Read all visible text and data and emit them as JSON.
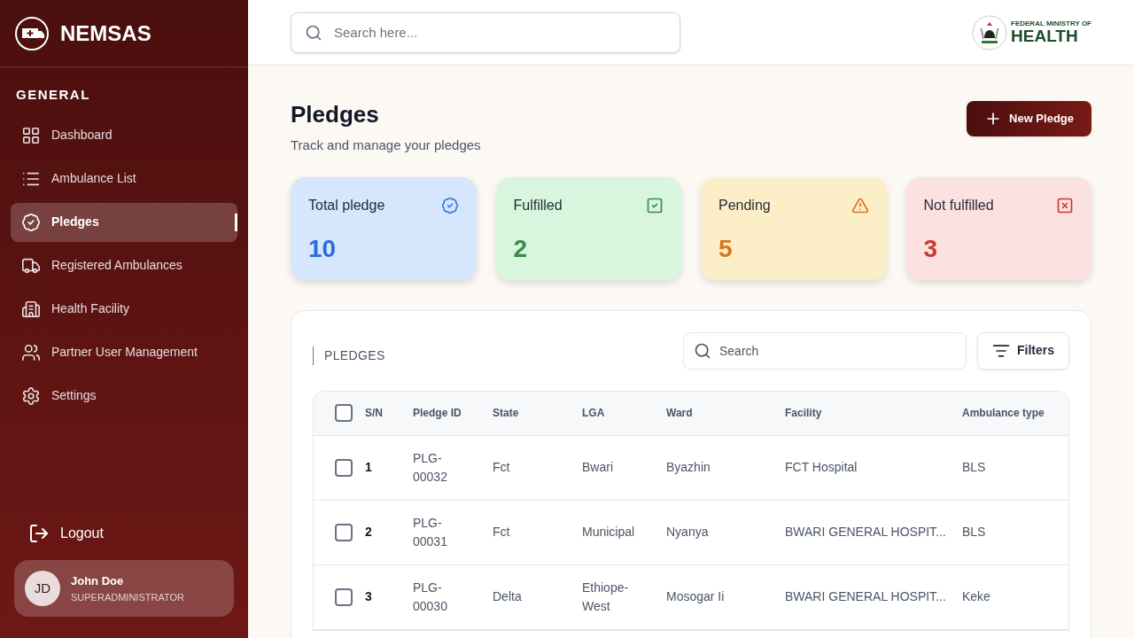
{
  "sidebar": {
    "brand": "NEMSAS",
    "section": "GENERAL",
    "items": [
      {
        "label": "Dashboard",
        "selected": false
      },
      {
        "label": "Ambulance List",
        "selected": false
      },
      {
        "label": "Pledges",
        "selected": true
      },
      {
        "label": "Registered Ambulances",
        "selected": false
      },
      {
        "label": "Health Facility",
        "selected": false
      },
      {
        "label": "Partner User Management",
        "selected": false
      },
      {
        "label": "Settings",
        "selected": false
      }
    ],
    "logout": "Logout",
    "user": {
      "initials": "JD",
      "name": "John Doe",
      "role": "SUPERADMINISTRATOR"
    }
  },
  "header": {
    "search_placeholder": "Search here...",
    "ministry_line": "FEDERAL MINISTRY OF",
    "ministry_name": "HEALTH"
  },
  "page": {
    "title": "Pledges",
    "subtitle": "Track and manage your pledges",
    "new_button": "New Pledge"
  },
  "stats": [
    {
      "label": "Total pledge",
      "value": "10",
      "kind": "total"
    },
    {
      "label": "Fulfilled",
      "value": "2",
      "kind": "fulfilled"
    },
    {
      "label": "Pending",
      "value": "5",
      "kind": "pending"
    },
    {
      "label": "Not fulfilled",
      "value": "3",
      "kind": "not_fulfilled"
    }
  ],
  "table": {
    "title": "PLEDGES",
    "search_placeholder": "Search",
    "filters": "Filters",
    "all_checked": false,
    "columns": [
      "S/N",
      "Pledge ID",
      "State",
      "LGA",
      "Ward",
      "Facility",
      "Ambulance type"
    ],
    "rows": [
      {
        "checked": false,
        "cells": [
          "1",
          "PLG-00032",
          "Fct",
          "Bwari",
          "Byazhin",
          "FCT Hospital",
          "BLS"
        ]
      },
      {
        "checked": false,
        "cells": [
          "2",
          "PLG-00031",
          "Fct",
          "Municipal",
          "Nyanya",
          "BWARI GENERAL HOSPIT...",
          "BLS"
        ]
      },
      {
        "checked": false,
        "cells": [
          "3",
          "PLG-00030",
          "Delta",
          "Ethiope-West",
          "Mosogar Ii",
          "BWARI GENERAL HOSPIT...",
          "Keke"
        ]
      }
    ]
  }
}
